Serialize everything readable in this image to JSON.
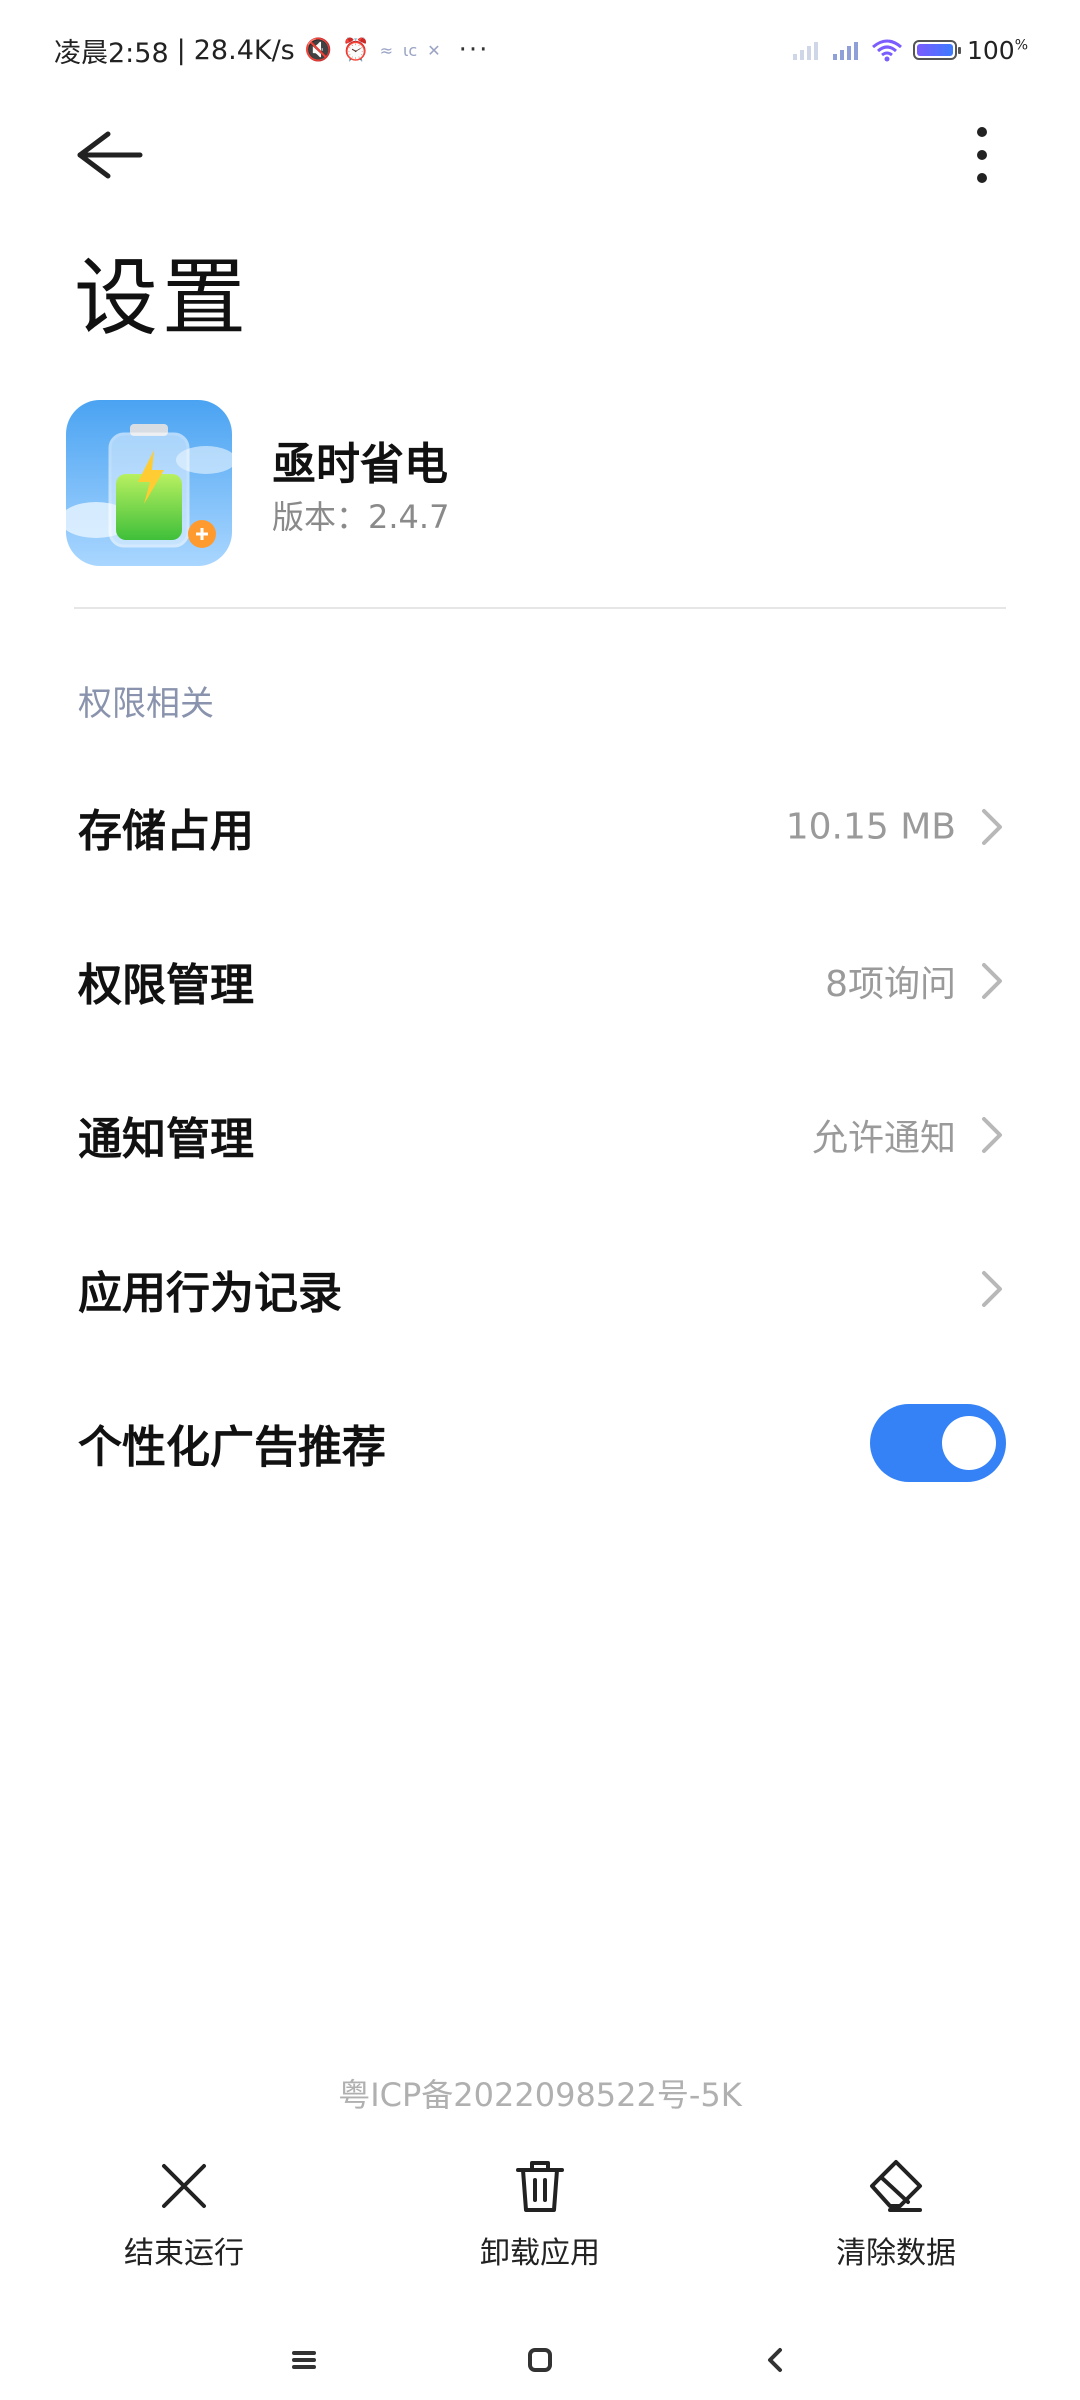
{
  "status_bar": {
    "time": "凌晨2:58",
    "separator": "|",
    "speed": "28.4K/s",
    "more": "···",
    "battery": "100",
    "battery_unit": "%"
  },
  "header": {
    "title": "设置"
  },
  "app": {
    "name": "亟时省电",
    "version": "版本：2.4.7"
  },
  "section": {
    "label": "权限相关"
  },
  "rows": [
    {
      "title": "存储占用",
      "value": "10.15 MB"
    },
    {
      "title": "权限管理",
      "value": "8项询问"
    },
    {
      "title": "通知管理",
      "value": "允许通知"
    },
    {
      "title": "应用行为记录",
      "value": ""
    },
    {
      "title": "个性化广告推荐",
      "toggle_on": true
    }
  ],
  "footer": {
    "icp": "粤ICP备2022098522号-5K",
    "actions": [
      {
        "label": "结束运行",
        "icon": "close-icon"
      },
      {
        "label": "卸载应用",
        "icon": "trash-icon"
      },
      {
        "label": "清除数据",
        "icon": "eraser-icon"
      }
    ]
  },
  "colors": {
    "accent": "#3482f6",
    "section_label": "#8a93ad",
    "secondary_text": "#9a9a9a"
  }
}
